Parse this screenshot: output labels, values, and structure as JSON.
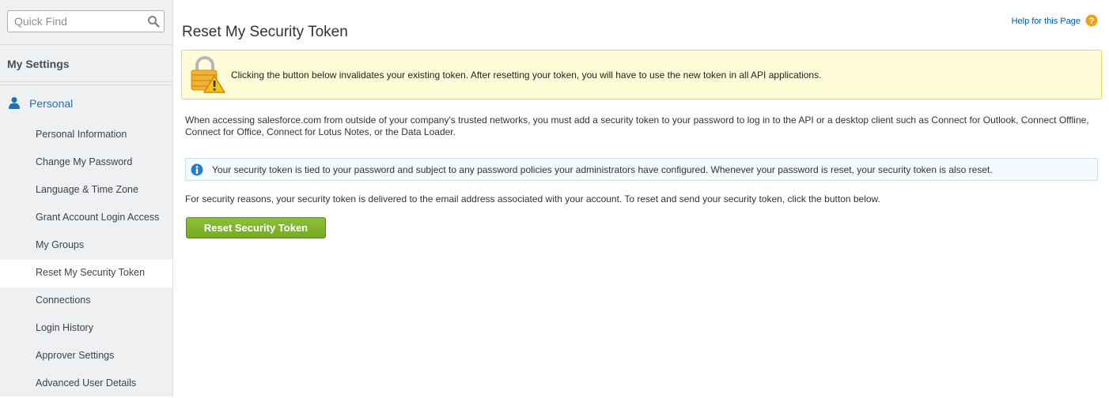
{
  "sidebar": {
    "search": {
      "placeholder": "Quick Find",
      "icon": "search-icon"
    },
    "section_title": "My Settings",
    "group": {
      "label": "Personal",
      "icon": "person-icon"
    },
    "items": [
      {
        "label": "Personal Information"
      },
      {
        "label": "Change My Password"
      },
      {
        "label": "Language & Time Zone"
      },
      {
        "label": "Grant Account Login Access"
      },
      {
        "label": "My Groups"
      },
      {
        "label": "Reset My Security Token",
        "active": true
      },
      {
        "label": "Connections"
      },
      {
        "label": "Login History"
      },
      {
        "label": "Approver Settings"
      },
      {
        "label": "Advanced User Details"
      }
    ]
  },
  "main": {
    "title": "Reset My Security Token",
    "help": {
      "label": "Help for this Page",
      "icon": "help-icon"
    },
    "warning": {
      "icon": "lock-warning-icon",
      "text": "Clicking the button below invalidates your existing token. After resetting your token, you will have to use the new token in all API applications."
    },
    "intro": "When accessing salesforce.com from outside of your company's trusted networks, you must add a security token to your password to log in to the API or a desktop client such as Connect for Outlook, Connect Offline, Connect for Office, Connect for Lotus Notes, or the Data Loader.",
    "info": {
      "icon": "info-icon",
      "text": "Your security token is tied to your password and subject to any password policies your administrators have configured. Whenever your password is reset, your security token is also reset."
    },
    "security_note": "For security reasons, your security token is delivered to the email address associated with your account. To reset and send your security token, click the button below.",
    "reset_button": "Reset Security Token"
  },
  "colors": {
    "accent_blue": "#1f72b5",
    "button_green": "#7fb22c",
    "warning_bg": "#fefdd8",
    "info_bg": "#f4fafd"
  }
}
